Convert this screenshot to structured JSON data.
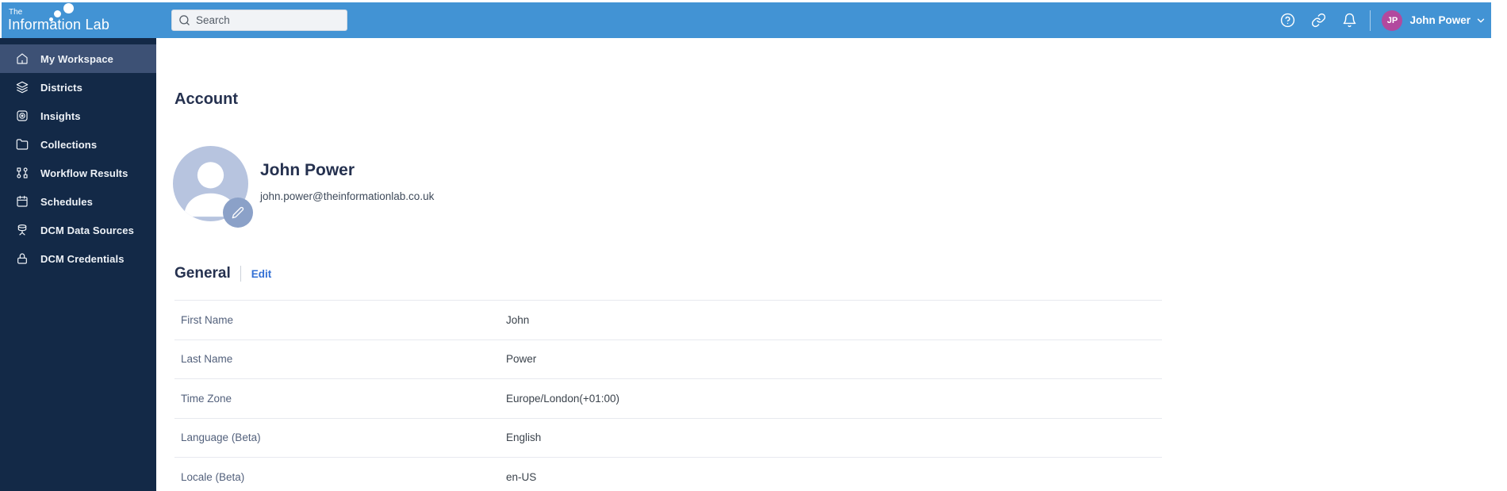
{
  "topbar": {
    "logo": {
      "line1": "The",
      "line2": "Information Lab"
    },
    "search": {
      "placeholder": "Search"
    },
    "user": {
      "initials": "JP",
      "name": "John Power"
    }
  },
  "sidebar": {
    "items": [
      {
        "label": "My Workspace",
        "icon": "home-icon",
        "active": true
      },
      {
        "label": "Districts",
        "icon": "layers-icon",
        "active": false
      },
      {
        "label": "Insights",
        "icon": "insights-icon",
        "active": false
      },
      {
        "label": "Collections",
        "icon": "folder-icon",
        "active": false
      },
      {
        "label": "Workflow Results",
        "icon": "workflow-icon",
        "active": false
      },
      {
        "label": "Schedules",
        "icon": "calendar-icon",
        "active": false
      },
      {
        "label": "DCM Data Sources",
        "icon": "database-icon",
        "active": false
      },
      {
        "label": "DCM Credentials",
        "icon": "lock-icon",
        "active": false
      }
    ]
  },
  "main": {
    "page_title": "Account",
    "profile": {
      "name": "John Power",
      "email": "john.power@theinformationlab.co.uk"
    },
    "general": {
      "heading": "General",
      "edit_label": "Edit",
      "fields": [
        {
          "label": "First Name",
          "value": "John"
        },
        {
          "label": "Last Name",
          "value": "Power"
        },
        {
          "label": "Time Zone",
          "value": "Europe/London(+01:00)"
        },
        {
          "label": "Language (Beta)",
          "value": "English"
        },
        {
          "label": "Locale (Beta)",
          "value": "en-US"
        }
      ]
    }
  },
  "colors": {
    "topbar_blue": "#4293d4",
    "sidebar_navy": "#132947",
    "sidebar_active": "#3d5175",
    "user_avatar_magenta": "#b2499e",
    "profile_avatar_fill": "#b7c4df",
    "edit_badge_fill": "#8ba1c8",
    "link_blue": "#3370d4",
    "heading_navy": "#25314f"
  }
}
